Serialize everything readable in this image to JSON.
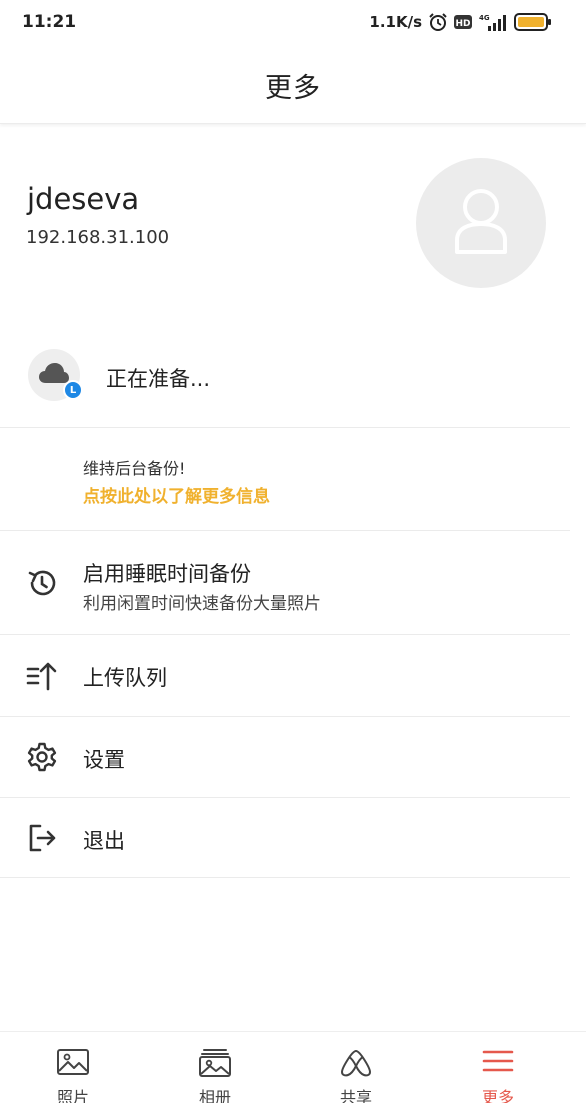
{
  "status_bar": {
    "time": "11:21",
    "net_speed": "1.1K/s",
    "hd_label": "HD",
    "network_label": "4G",
    "battery_color": "#f0b12e"
  },
  "header": {
    "title": "更多"
  },
  "profile": {
    "name": "jdeseva",
    "ip": "192.168.31.100",
    "avatar_icon": "person-placeholder-icon"
  },
  "backup": {
    "status_text": "正在准备...",
    "badge_letter": "L",
    "badge_color": "#1e88e5"
  },
  "keep_background": {
    "line1": "维持后台备份!",
    "link": "点按此处以了解更多信息",
    "link_color": "#f0b12e"
  },
  "menu": {
    "sleep_backup_title": "启用睡眠时间备份",
    "sleep_backup_subtitle": "利用闲置时间快速备份大量照片",
    "upload_queue": "上传队列",
    "settings": "设置",
    "logout": "退出"
  },
  "bottom_nav": {
    "items": [
      {
        "label": "照片",
        "icon": "photo-icon",
        "active": false
      },
      {
        "label": "相册",
        "icon": "album-icon",
        "active": false
      },
      {
        "label": "共享",
        "icon": "share-icon",
        "active": false
      },
      {
        "label": "更多",
        "icon": "menu-icon",
        "active": true
      }
    ],
    "active_color": "#e5584c"
  }
}
